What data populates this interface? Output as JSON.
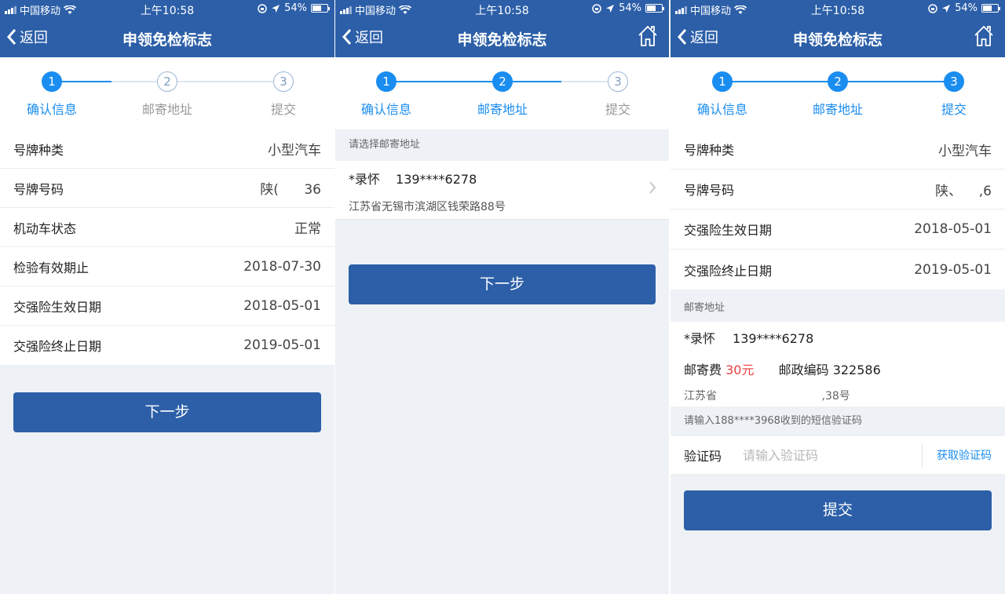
{
  "status": {
    "carrier": "中国移动",
    "time": "上午10:58",
    "battery": "54%"
  },
  "nav": {
    "back_label": "返回",
    "title": "申领免检标志"
  },
  "steps": [
    {
      "num": "1",
      "label": "确认信息"
    },
    {
      "num": "2",
      "label": "邮寄地址"
    },
    {
      "num": "3",
      "label": "提交"
    }
  ],
  "screen1": {
    "rows": [
      {
        "label": "号牌种类",
        "value": "小型汽车"
      },
      {
        "label": "号牌号码",
        "value": "陕(      36"
      },
      {
        "label": "机动车状态",
        "value": "正常"
      },
      {
        "label": "检验有效期止",
        "value": "2018-07-30"
      },
      {
        "label": "交强险生效日期",
        "value": "2018-05-01"
      },
      {
        "label": "交强险终止日期",
        "value": "2019-05-01"
      }
    ],
    "next_label": "下一步"
  },
  "screen2": {
    "section_title": "请选择邮寄地址",
    "address": {
      "name": "*录怀",
      "phone": "139****6278",
      "detail": "江苏省无锡市滨湖区钱荣路88号"
    },
    "next_label": "下一步"
  },
  "screen3": {
    "rows": [
      {
        "label": "号牌种类",
        "value": "小型汽车"
      },
      {
        "label": "号牌号码",
        "value": "陕、    ,6"
      },
      {
        "label": "交强险生效日期",
        "value": "2018-05-01"
      },
      {
        "label": "交强险终止日期",
        "value": "2019-05-01"
      }
    ],
    "mail_title": "邮寄地址",
    "mail": {
      "name": "*录怀",
      "phone": "139****6278",
      "fee_label": "邮寄费",
      "fee_value": "30元",
      "zip_label": "邮政编码",
      "zip_value": "322586",
      "addr": "江苏省                              ,38号"
    },
    "sms_hint": "请输入188****3968收到的短信验证码",
    "code_label": "验证码",
    "code_placeholder": "请输入验证码",
    "get_code_label": "获取验证码",
    "submit_label": "提交"
  },
  "colors": {
    "primary": "#2c5fa8",
    "accent": "#1a8df0",
    "fee": "#e84040",
    "background": "#eef2f6"
  }
}
